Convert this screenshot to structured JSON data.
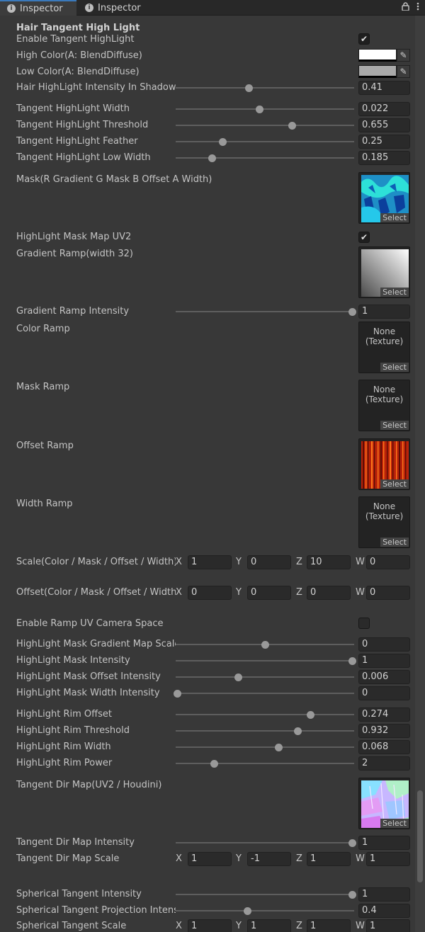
{
  "tabs": [
    {
      "label": "Inspector",
      "active": true
    },
    {
      "label": "Inspector",
      "active": false
    }
  ],
  "colors": {
    "accent": "#3a79bb",
    "background": "#383838",
    "field": "#2a2a2a"
  },
  "section_title": "Hair Tangent High Light",
  "checkboxes": [
    {
      "label": "Enable Tangent HighLight",
      "checked": true
    },
    {
      "label": "HighLight Mask Map UV2",
      "checked": true
    },
    {
      "label": "Enable Ramp UV Camera Space",
      "checked": false
    }
  ],
  "colorfields": [
    {
      "label": "High Color(A: BlendDiffuse)",
      "color": "#ffffff"
    },
    {
      "label": "Low Color(A: BlendDiffuse)",
      "color": "#a9a9a9"
    }
  ],
  "sliders": [
    {
      "label": "Hair HighLight Intensity In Shadow",
      "value": "0.41",
      "t": 0.41
    },
    {
      "label": "Tangent HighLight Width",
      "value": "0.022",
      "t": 0.47
    },
    {
      "label": "Tangent HighLight Threshold",
      "value": "0.655",
      "t": 0.655
    },
    {
      "label": "Tangent HighLight Feather",
      "value": "0.25",
      "t": 0.26
    },
    {
      "label": "Tangent HighLight Low Width",
      "value": "0.185",
      "t": 0.2
    },
    {
      "label": "Gradient Ramp Intensity",
      "value": "1",
      "t": 1
    },
    {
      "label": "HighLight Mask Gradient Map Scale",
      "value": "0",
      "t": 0.5
    },
    {
      "label": "HighLight Mask Intensity",
      "value": "1",
      "t": 1
    },
    {
      "label": "HighLight Mask Offset Intensity",
      "value": "0.006",
      "t": 0.35
    },
    {
      "label": "HighLight Mask Width Intensity",
      "value": "0",
      "t": 0
    },
    {
      "label": "HighLight Rim Offset",
      "value": "0.274",
      "t": 0.76
    },
    {
      "label": "HighLight Rim Threshold",
      "value": "0.932",
      "t": 0.69
    },
    {
      "label": "HighLight Rim Width",
      "value": "0.068",
      "t": 0.58
    },
    {
      "label": "HighLight Rim Power",
      "value": "2",
      "t": 0.21
    },
    {
      "label": "Tangent Dir Map Intensity",
      "value": "1",
      "t": 1
    },
    {
      "label": "Spherical Tangent Intensity",
      "value": "1",
      "t": 1
    },
    {
      "label": "Spherical Tangent Projection Intensity",
      "value": "0.4",
      "t": 0.4
    }
  ],
  "textures": [
    {
      "label": "Mask(R Gradient G Mask B Offset A Width)",
      "none": false,
      "art": "mask-map"
    },
    {
      "label": "Gradient Ramp(width 32)",
      "none": false,
      "art": "gradient-ramp"
    },
    {
      "label": "Color Ramp",
      "none": true,
      "none_text": "None\n(Texture)"
    },
    {
      "label": "Mask Ramp",
      "none": true,
      "none_text": "None\n(Texture)"
    },
    {
      "label": "Offset Ramp",
      "none": false,
      "art": "offset-ramp"
    },
    {
      "label": "Width Ramp",
      "none": true,
      "none_text": "None\n(Texture)"
    },
    {
      "label": "Tangent Dir Map(UV2 / Houdini)",
      "none": false,
      "art": "tangent-dir-map"
    }
  ],
  "texture_select_label": "Select",
  "vectors": [
    {
      "label": "Scale(Color / Mask / Offset / Width)",
      "x": "1",
      "y": "0",
      "z": "10",
      "w": "0"
    },
    {
      "label": "Offset(Color / Mask / Offset / Width)",
      "x": "0",
      "y": "0",
      "z": "0",
      "w": "0"
    },
    {
      "label": "Tangent Dir Map Scale",
      "x": "1",
      "y": "-1",
      "z": "1",
      "w": "1"
    },
    {
      "label": "Spherical Tangent Scale",
      "x": "1",
      "y": "1",
      "z": "1",
      "w": "1"
    }
  ],
  "vector_axis_labels": [
    "X",
    "Y",
    "Z",
    "W"
  ]
}
